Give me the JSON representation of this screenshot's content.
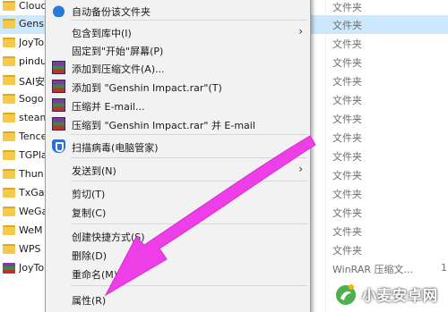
{
  "explorer": {
    "rows": [
      {
        "name": "Cloud",
        "type": "文件夹",
        "size": "",
        "selected": false,
        "kind": "folder"
      },
      {
        "name": "Gens",
        "type": "文件夹",
        "size": "",
        "selected": true,
        "kind": "folder"
      },
      {
        "name": "JoyTo",
        "type": "文件夹",
        "size": "",
        "selected": false,
        "kind": "folder"
      },
      {
        "name": "pindu",
        "type": "文件夹",
        "size": "",
        "selected": false,
        "kind": "folder"
      },
      {
        "name": "SAI安",
        "type": "文件夹",
        "size": "",
        "selected": false,
        "kind": "folder"
      },
      {
        "name": "Sogo",
        "type": "文件夹",
        "size": "",
        "selected": false,
        "kind": "folder"
      },
      {
        "name": "steam",
        "type": "文件夹",
        "size": "",
        "selected": false,
        "kind": "folder"
      },
      {
        "name": "Tence",
        "type": "文件夹",
        "size": "",
        "selected": false,
        "kind": "folder"
      },
      {
        "name": "TGPla",
        "type": "文件夹",
        "size": "",
        "selected": false,
        "kind": "folder"
      },
      {
        "name": "Thun",
        "type": "文件夹",
        "size": "",
        "selected": false,
        "kind": "folder"
      },
      {
        "name": "TxGa",
        "type": "文件夹",
        "size": "",
        "selected": false,
        "kind": "folder"
      },
      {
        "name": "WeGa",
        "type": "文件夹",
        "size": "",
        "selected": false,
        "kind": "folder"
      },
      {
        "name": "WeM",
        "type": "文件夹",
        "size": "",
        "selected": false,
        "kind": "folder"
      },
      {
        "name": "WPS",
        "type": "文件夹",
        "size": "",
        "selected": false,
        "kind": "folder"
      },
      {
        "name": "JoyTo",
        "type": "WinRAR 压缩文...",
        "size": "1,",
        "selected": false,
        "kind": "rar"
      }
    ]
  },
  "context_menu": {
    "items": [
      {
        "label": "自动备份该文件夹",
        "icon": "cloud-backup-icon"
      },
      {
        "label": "包含到库中(I)",
        "icon": "",
        "submenu": true
      },
      {
        "label": "固定到\"开始\"屏幕(P)",
        "icon": ""
      },
      {
        "label": "添加到压缩文件(A)...",
        "icon": "winrar-icon"
      },
      {
        "label": "添加到 \"Genshin Impact.rar\"(T)",
        "icon": "winrar-icon"
      },
      {
        "label": "压缩并 E-mail...",
        "icon": "winrar-icon"
      },
      {
        "label": "压缩到 \"Genshin Impact.rar\" 并 E-mail",
        "icon": "winrar-icon"
      },
      {
        "label": "扫描病毒(电脑管家)",
        "icon": "shield-icon"
      },
      {
        "label": "发送到(N)",
        "icon": "",
        "submenu": true
      },
      {
        "label": "剪切(T)",
        "icon": ""
      },
      {
        "label": "复制(C)",
        "icon": ""
      },
      {
        "label": "创建快捷方式(S)",
        "icon": ""
      },
      {
        "label": "删除(D)",
        "icon": ""
      },
      {
        "label": "重命名(M)",
        "icon": ""
      },
      {
        "label": "属性(R)",
        "icon": ""
      }
    ],
    "submenu_arrow": "›"
  },
  "annotation": {
    "color": "#ee3ee8",
    "target": "属性(R)"
  },
  "watermark": {
    "text": "小麦安卓网"
  },
  "colors": {
    "selected_row": "#cce8ff",
    "menu_bg": "#f2f2f2",
    "folder": "#f6c94a"
  }
}
